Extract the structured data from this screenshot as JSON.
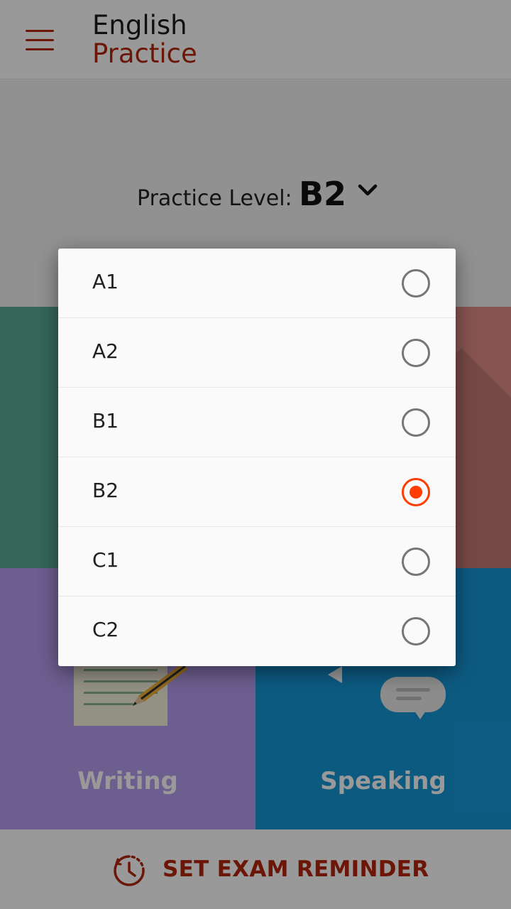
{
  "header": {
    "brand_line1": "English",
    "brand_line2": "Practice"
  },
  "level_selector": {
    "label": "Practice Level:",
    "value": "B2"
  },
  "tiles": [
    {
      "label": "",
      "color": "#5aa995"
    },
    {
      "label": "",
      "color": "#e18d87"
    },
    {
      "label": "Writing",
      "color": "#b59dee"
    },
    {
      "label": "Speaking",
      "color": "#1697d8"
    }
  ],
  "footer": {
    "reminder_label": "SET EXAM REMINDER"
  },
  "dialog": {
    "options": [
      {
        "label": "A1",
        "selected": false
      },
      {
        "label": "A2",
        "selected": false
      },
      {
        "label": "B1",
        "selected": false
      },
      {
        "label": "B2",
        "selected": true
      },
      {
        "label": "C1",
        "selected": false
      },
      {
        "label": "C2",
        "selected": false
      }
    ]
  },
  "colors": {
    "accent": "#b3260d",
    "radio_selected": "#ff3d00",
    "radio_unselected": "#757575"
  },
  "icons": [
    "menu-icon",
    "chevron-down-icon",
    "paper-icon",
    "pencil-icon",
    "speech-bubble-icon",
    "clock-reminder-icon"
  ]
}
